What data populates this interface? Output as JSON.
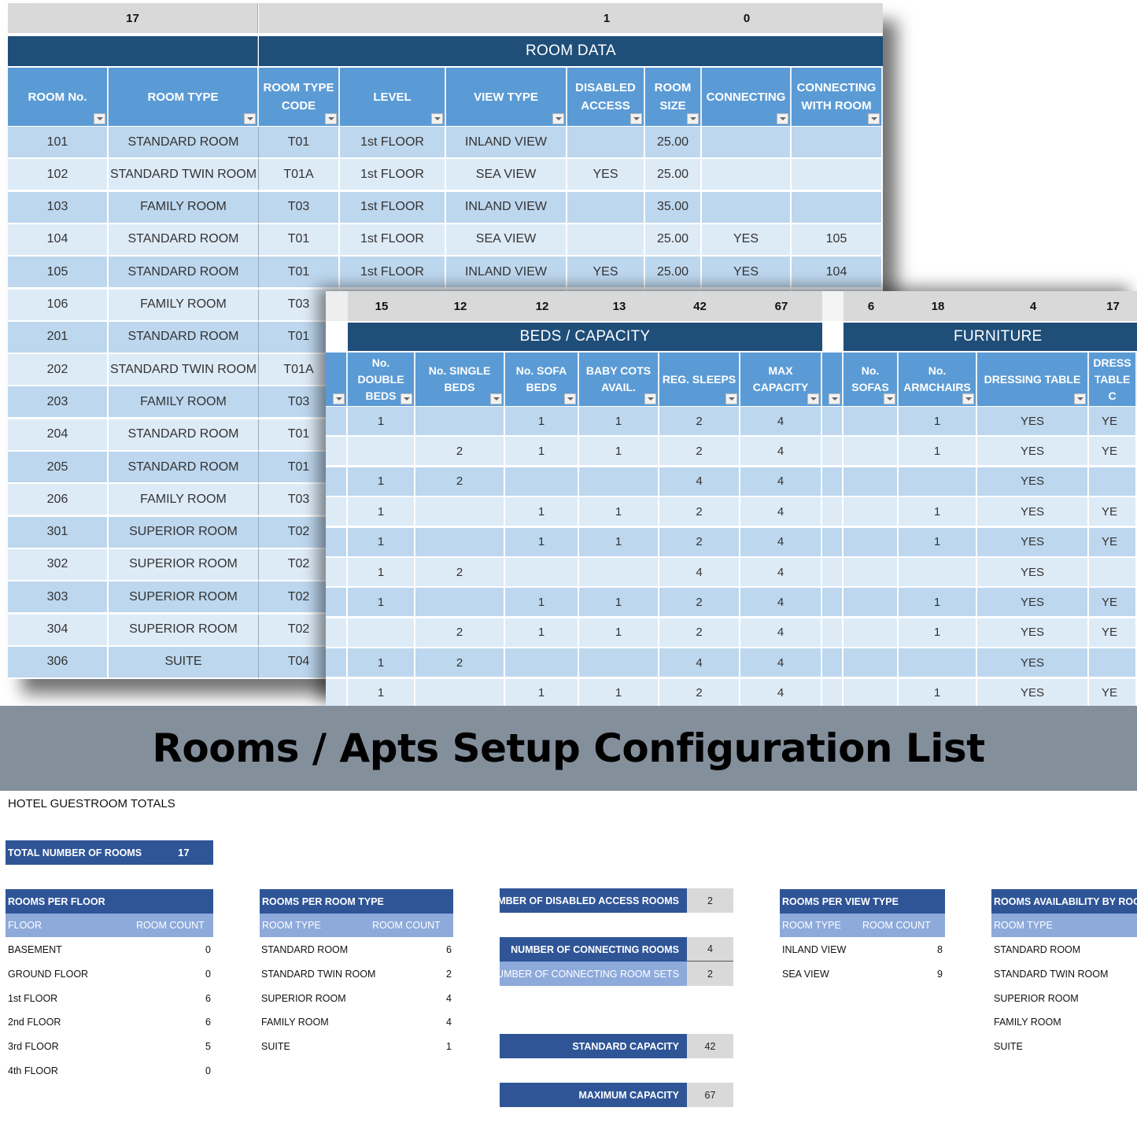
{
  "room_sheet": {
    "totals_row": {
      "room_no": "17",
      "disabled_access": "1",
      "room_size": "0"
    },
    "section_title": "ROOM DATA",
    "columns": [
      "ROOM No.",
      "ROOM TYPE",
      "ROOM TYPE CODE",
      "LEVEL",
      "VIEW TYPE",
      "DISABLED ACCESS",
      "ROOM SIZE",
      "CONNECTING",
      "CONNECTING WITH ROOM"
    ],
    "rows": [
      [
        "101",
        "STANDARD ROOM",
        "T01",
        "1st FLOOR",
        "INLAND VIEW",
        "",
        "25.00",
        "",
        ""
      ],
      [
        "102",
        "STANDARD TWIN ROOM",
        "T01A",
        "1st FLOOR",
        "SEA VIEW",
        "YES",
        "25.00",
        "",
        ""
      ],
      [
        "103",
        "FAMILY ROOM",
        "T03",
        "1st FLOOR",
        "INLAND VIEW",
        "",
        "35.00",
        "",
        ""
      ],
      [
        "104",
        "STANDARD ROOM",
        "T01",
        "1st FLOOR",
        "SEA VIEW",
        "",
        "25.00",
        "YES",
        "105"
      ],
      [
        "105",
        "STANDARD ROOM",
        "T01",
        "1st FLOOR",
        "INLAND VIEW",
        "YES",
        "25.00",
        "YES",
        "104"
      ],
      [
        "106",
        "FAMILY ROOM",
        "T03"
      ],
      [
        "201",
        "STANDARD ROOM",
        "T01"
      ],
      [
        "202",
        "STANDARD TWIN ROOM",
        "T01A"
      ],
      [
        "203",
        "FAMILY ROOM",
        "T03"
      ],
      [
        "204",
        "STANDARD ROOM",
        "T01"
      ],
      [
        "205",
        "STANDARD ROOM",
        "T01"
      ],
      [
        "206",
        "FAMILY ROOM",
        "T03"
      ],
      [
        "301",
        "SUPERIOR ROOM",
        "T02"
      ],
      [
        "302",
        "SUPERIOR ROOM",
        "T02"
      ],
      [
        "303",
        "SUPERIOR ROOM",
        "T02"
      ],
      [
        "304",
        "SUPERIOR ROOM",
        "T02"
      ],
      [
        "306",
        "SUITE",
        "T04"
      ]
    ]
  },
  "beds_sheet": {
    "totals_row": [
      "15",
      "12",
      "12",
      "13",
      "42",
      "67"
    ],
    "section_title": "BEDS / CAPACITY",
    "columns": [
      "No. DOUBLE BEDS",
      "No. SINGLE BEDS",
      "No. SOFA BEDS",
      "BABY COTS AVAIL.",
      "REG. SLEEPS",
      "MAX CAPACITY"
    ],
    "rows": [
      [
        "1",
        "",
        "1",
        "1",
        "2",
        "4"
      ],
      [
        "",
        "2",
        "1",
        "1",
        "2",
        "4"
      ],
      [
        "1",
        "2",
        "",
        "",
        "4",
        "4"
      ],
      [
        "1",
        "",
        "1",
        "1",
        "2",
        "4"
      ],
      [
        "1",
        "",
        "1",
        "1",
        "2",
        "4"
      ],
      [
        "1",
        "2",
        "",
        "",
        "4",
        "4"
      ],
      [
        "1",
        "",
        "1",
        "1",
        "2",
        "4"
      ],
      [
        "",
        "2",
        "1",
        "1",
        "2",
        "4"
      ],
      [
        "1",
        "2",
        "",
        "",
        "4",
        "4"
      ],
      [
        "1",
        "",
        "1",
        "1",
        "2",
        "4"
      ]
    ]
  },
  "furniture_sheet": {
    "totals_row": [
      "6",
      "18",
      "4",
      "17"
    ],
    "section_title": "FURNITURE",
    "columns": [
      "No. SOFAS",
      "No. ARMCHAIRS",
      "DRESSING TABLE",
      "DRESS TABLE C"
    ],
    "rows": [
      [
        "",
        "1",
        "YES",
        "YE"
      ],
      [
        "",
        "1",
        "YES",
        "YE"
      ],
      [
        "",
        "",
        "YES",
        ""
      ],
      [
        "",
        "1",
        "YES",
        "YE"
      ],
      [
        "",
        "1",
        "YES",
        "YE"
      ],
      [
        "",
        "",
        "YES",
        ""
      ],
      [
        "",
        "1",
        "YES",
        "YE"
      ],
      [
        "",
        "1",
        "YES",
        "YE"
      ],
      [
        "",
        "",
        "YES",
        ""
      ],
      [
        "",
        "1",
        "YES",
        "YE"
      ]
    ]
  },
  "banner": {
    "title": "Rooms / Apts Setup Configuration List"
  },
  "dashboard": {
    "title": "HOTEL GUESTROOM TOTALS",
    "total_rooms": {
      "label": "TOTAL NUMBER OF ROOMS",
      "value": "17"
    },
    "per_floor": {
      "title": "ROOMS PER FLOOR",
      "col1": "FLOOR",
      "col2": "ROOM COUNT",
      "rows": [
        {
          "label": "BASEMENT",
          "count": "0"
        },
        {
          "label": "GROUND FLOOR",
          "count": "0"
        },
        {
          "label": "1st FLOOR",
          "count": "6"
        },
        {
          "label": "2nd FLOOR",
          "count": "6"
        },
        {
          "label": "3rd FLOOR",
          "count": "5"
        },
        {
          "label": "4th FLOOR",
          "count": "0"
        }
      ]
    },
    "per_type": {
      "title": "ROOMS PER ROOM TYPE",
      "col1": "ROOM TYPE",
      "col2": "ROOM COUNT",
      "rows": [
        {
          "label": "STANDARD ROOM",
          "count": "6"
        },
        {
          "label": "STANDARD TWIN ROOM",
          "count": "2"
        },
        {
          "label": "SUPERIOR ROOM",
          "count": "4"
        },
        {
          "label": "FAMILY ROOM",
          "count": "4"
        },
        {
          "label": "SUITE",
          "count": "1"
        }
      ]
    },
    "stats": {
      "disabled": {
        "label": "NUMBER OF DISABLED ACCESS ROOMS",
        "value": "2"
      },
      "connecting": {
        "label": "NUMBER OF CONNECTING ROOMS",
        "value": "4"
      },
      "connecting_sets": {
        "label": "NUMBER OF CONNECTING ROOM SETS",
        "value": "2"
      },
      "standard_capacity": {
        "label": "STANDARD CAPACITY",
        "value": "42"
      },
      "max_capacity": {
        "label": "MAXIMUM CAPACITY",
        "value": "67"
      }
    },
    "per_view": {
      "title": "ROOMS PER VIEW TYPE",
      "col1": "ROOM TYPE",
      "col2": "ROOM COUNT",
      "rows": [
        {
          "label": "INLAND VIEW",
          "count": "8"
        },
        {
          "label": "SEA VIEW",
          "count": "9"
        }
      ]
    },
    "availability": {
      "title": "ROOMS AVAILABILITY BY ROOM",
      "col1": "ROOM TYPE",
      "rows": [
        {
          "label": "STANDARD ROOM"
        },
        {
          "label": "STANDARD TWIN ROOM"
        },
        {
          "label": "SUPERIOR ROOM"
        },
        {
          "label": "FAMILY ROOM"
        },
        {
          "label": "SUITE"
        }
      ]
    }
  }
}
